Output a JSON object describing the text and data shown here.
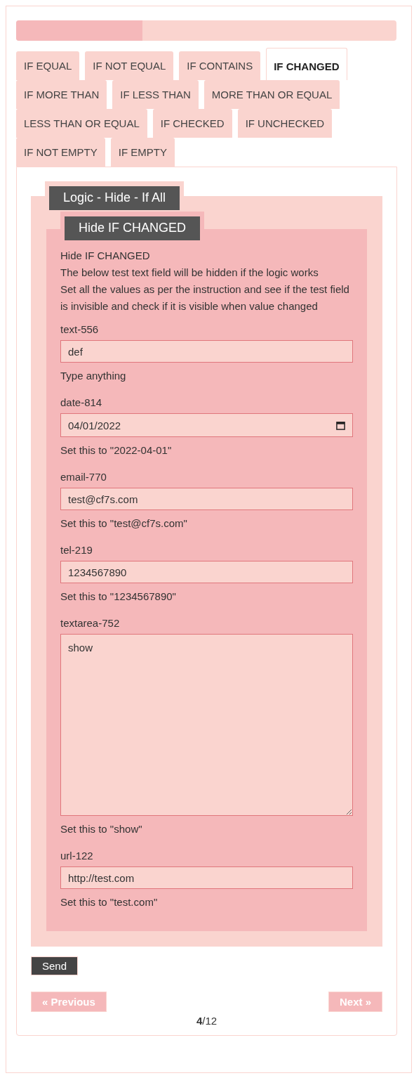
{
  "progress": {
    "level": 0.333
  },
  "tabs": [
    {
      "label": "IF EQUAL",
      "selected": false
    },
    {
      "label": "IF NOT EQUAL",
      "selected": false
    },
    {
      "label": "IF CONTAINS",
      "selected": false
    },
    {
      "label": "IF CHANGED",
      "selected": true
    },
    {
      "label": "IF MORE THAN",
      "selected": false
    },
    {
      "label": "IF LESS THAN",
      "selected": false
    },
    {
      "label": "MORE THAN OR EQUAL",
      "selected": false
    },
    {
      "label": "LESS THAN OR EQUAL",
      "selected": false
    },
    {
      "label": "IF CHECKED",
      "selected": false
    },
    {
      "label": "IF UNCHECKED",
      "selected": false
    },
    {
      "label": "IF NOT EMPTY",
      "selected": false
    },
    {
      "label": "IF EMPTY",
      "selected": false
    }
  ],
  "outer_fieldset": {
    "legend": "Logic - Hide - If All"
  },
  "inner_fieldset": {
    "legend": "Hide IF CHANGED",
    "description": [
      "Hide IF CHANGED",
      "The below test text field will be hidden if the logic works",
      "Set all the values as per the instruction and see if the test field is invisible and check if it is visible when value changed"
    ],
    "fields": [
      {
        "kind": "text",
        "label": "text-556",
        "value": "def",
        "hint": "Type anything"
      },
      {
        "kind": "date",
        "label": "date-814",
        "value": "04/01/2022",
        "hint": "Set this to \"2022-04-01\""
      },
      {
        "kind": "text",
        "label": "email-770",
        "value": "test@cf7s.com",
        "hint": "Set this to \"test@cf7s.com\""
      },
      {
        "kind": "text",
        "label": "tel-219",
        "value": "1234567890",
        "hint": "Set this to \"1234567890\""
      },
      {
        "kind": "textarea",
        "label": "textarea-752",
        "value": "show",
        "hint": "Set this to \"show\""
      },
      {
        "kind": "text",
        "label": "url-122",
        "value": "http://test.com",
        "hint": "Set this to \"test.com\""
      }
    ]
  },
  "send_button": "Send",
  "previous_button": "« Previous",
  "next_button": "Next »",
  "page_counter": "**4**/12"
}
